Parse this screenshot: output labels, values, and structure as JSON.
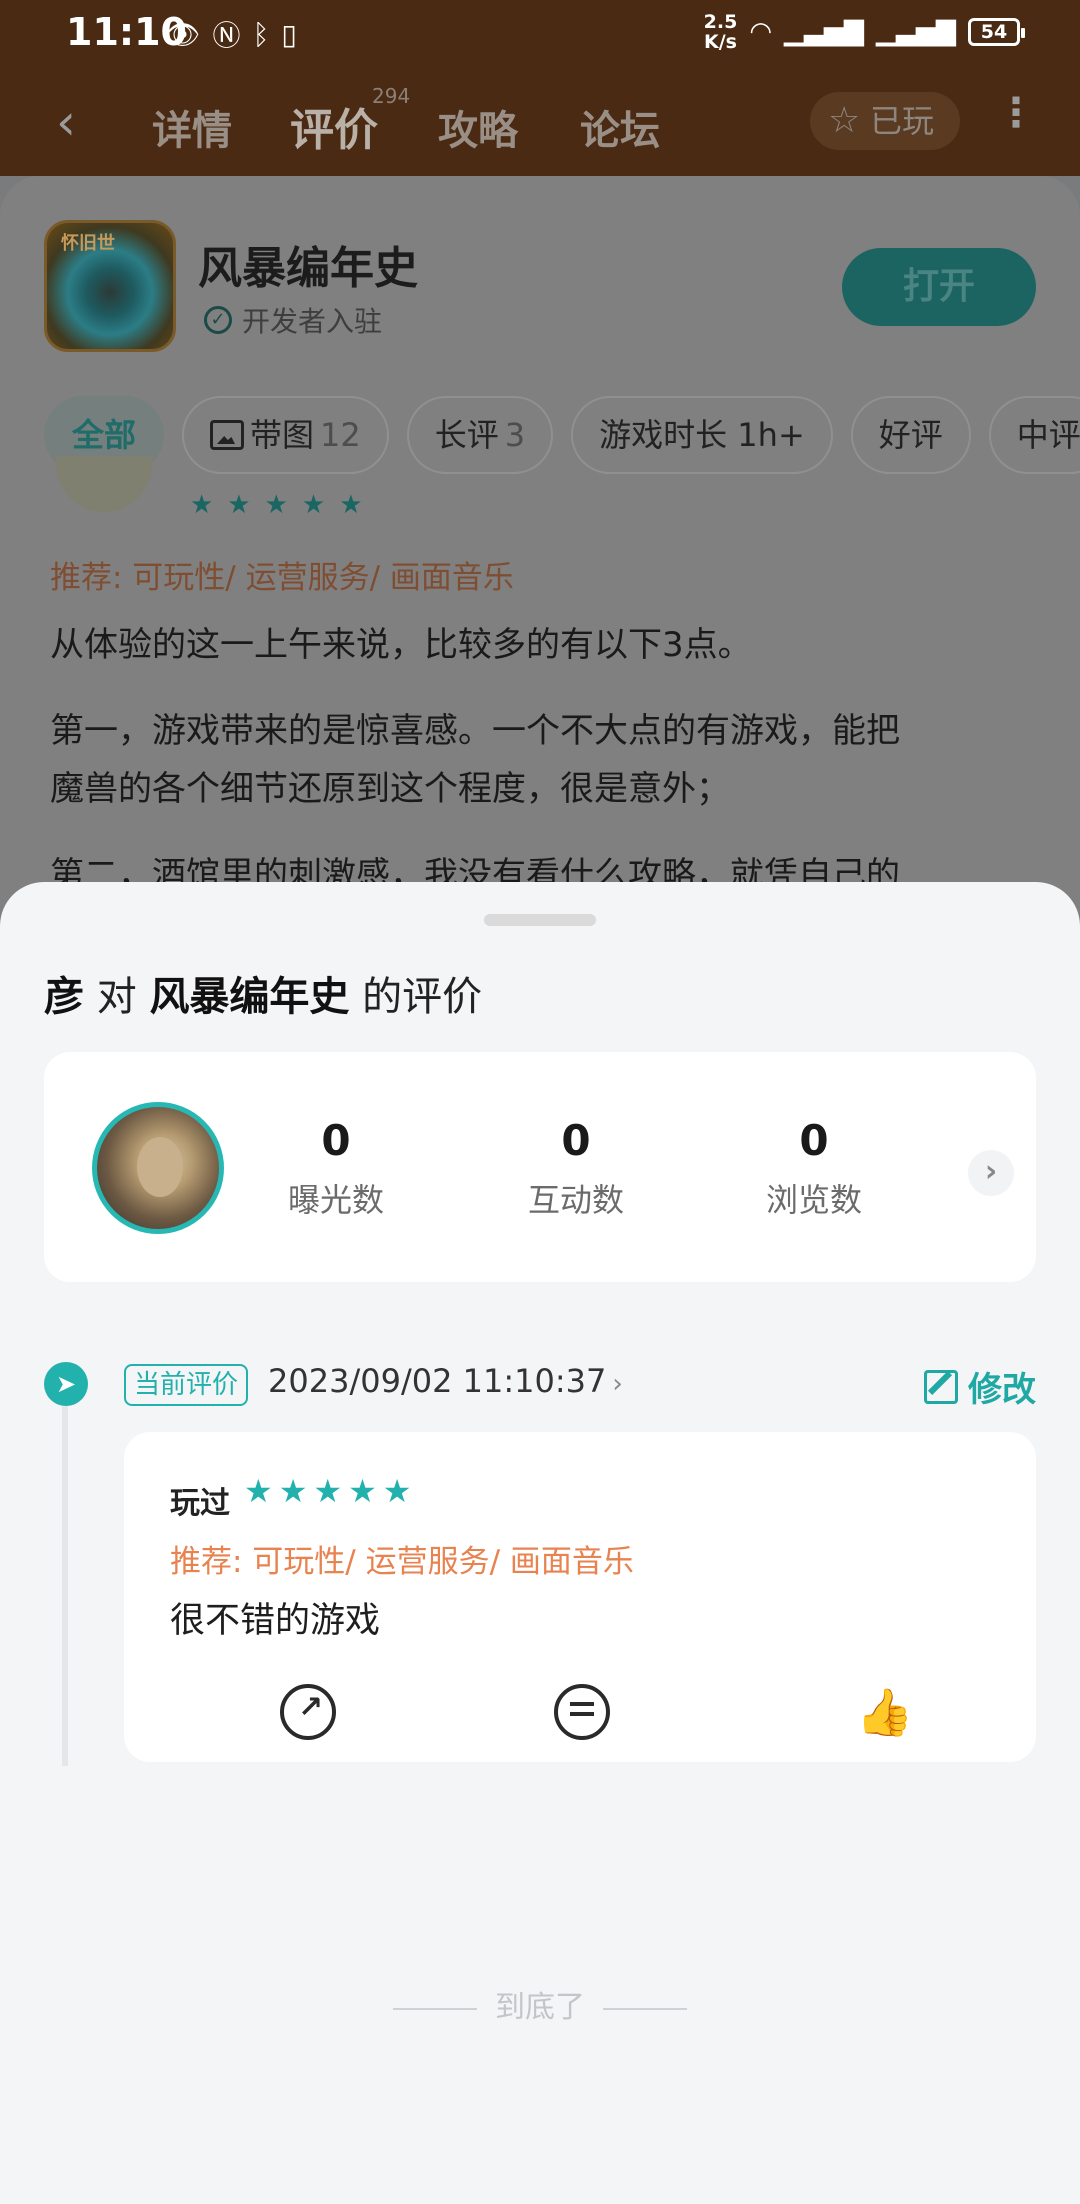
{
  "status_bar": {
    "time": "11:10",
    "net_speed_top": "2.5",
    "net_speed_bottom": "K/s",
    "battery": "54"
  },
  "nav": {
    "tabs": [
      "详情",
      "评价",
      "攻略",
      "论坛"
    ],
    "review_count": "294",
    "played_label": "已玩"
  },
  "app": {
    "icon_label": "怀旧世",
    "title": "风暴编年史",
    "developer_badge": "开发者入驻",
    "open_button": "打开"
  },
  "filters": [
    {
      "label": "全部",
      "count": ""
    },
    {
      "label": "带图",
      "count": "12"
    },
    {
      "label": "长评",
      "count": "3"
    },
    {
      "label": "游戏时长 1h+",
      "count": ""
    },
    {
      "label": "好评",
      "count": ""
    },
    {
      "label": "中评",
      "count": ""
    }
  ],
  "background_review": {
    "recommend": "推荐: 可玩性/ 运营服务/ 画面音乐",
    "p1": "从体验的这一上午来说，比较多的有以下3点。",
    "p2_line1": "第一，游戏带来的是惊喜感。一个不大点的有游戏，能把",
    "p2_line2": "魔兽的各个细节还原到这个程度，很是意外；",
    "p3_line1": "第二，酒馆里的刺激感，我没有看什么攻略，就凭自己的"
  },
  "sheet": {
    "title_user": "彦",
    "title_mid": "对",
    "title_game": "风暴编年史",
    "title_tail": "的评价",
    "stats": [
      {
        "value": "0",
        "label": "曝光数"
      },
      {
        "value": "0",
        "label": "互动数"
      },
      {
        "value": "0",
        "label": "浏览数"
      }
    ],
    "current_tag": "当前评价",
    "date": "2023/09/02 11:10:37",
    "edit_label": "修改",
    "played_label": "玩过",
    "rating_stars": 5,
    "recommend": "推荐: 可玩性/ 运营服务/ 画面音乐",
    "review_text": "很不错的游戏",
    "end_text": "到底了"
  },
  "colors": {
    "accent": "#22b1ad",
    "recommend": "#e88350",
    "top_bar": "#4a2a12"
  }
}
